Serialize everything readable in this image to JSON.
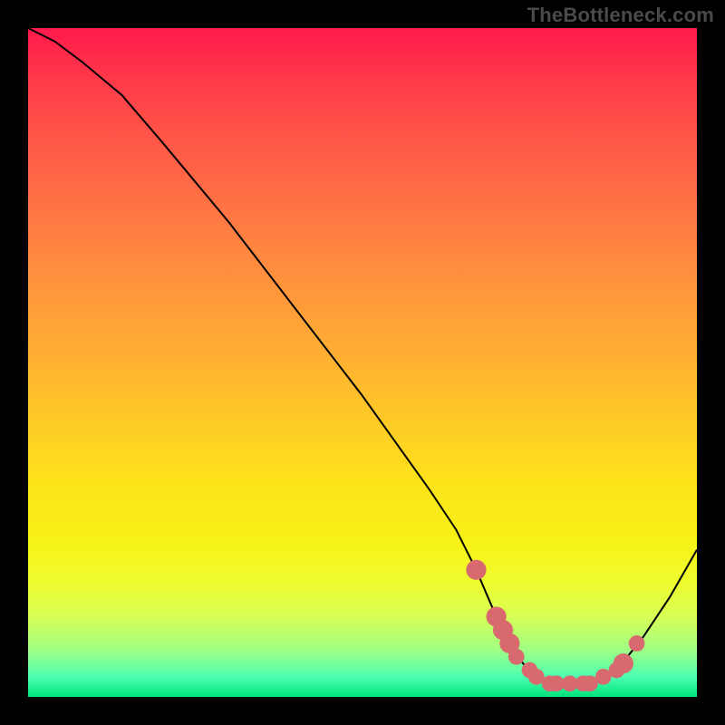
{
  "watermark": "TheBottleneck.com",
  "chart_data": {
    "type": "line",
    "title": "",
    "xlabel": "",
    "ylabel": "",
    "xlim": [
      0,
      100
    ],
    "ylim": [
      0,
      100
    ],
    "series": [
      {
        "name": "curve",
        "x": [
          0,
          4,
          8,
          14,
          20,
          30,
          40,
          50,
          60,
          64,
          67,
          70,
          72,
          74,
          76,
          78,
          80,
          82,
          84,
          86,
          88,
          92,
          96,
          100
        ],
        "values": [
          100,
          98,
          95,
          90,
          83,
          71,
          58,
          45,
          31,
          25,
          19,
          12,
          8,
          5,
          3,
          2,
          2,
          2,
          2,
          3,
          4,
          9,
          15,
          22
        ]
      }
    ],
    "markers": {
      "name": "highlighted-points",
      "color": "#d86a6f",
      "points": [
        {
          "x": 67,
          "y": 19,
          "r": 1.5
        },
        {
          "x": 70,
          "y": 12,
          "r": 1.5
        },
        {
          "x": 71,
          "y": 10,
          "r": 1.5
        },
        {
          "x": 72,
          "y": 8,
          "r": 1.5
        },
        {
          "x": 73,
          "y": 6,
          "r": 1.2
        },
        {
          "x": 75,
          "y": 4,
          "r": 1.2
        },
        {
          "x": 76,
          "y": 3,
          "r": 1.2
        },
        {
          "x": 78,
          "y": 2,
          "r": 1.2
        },
        {
          "x": 79,
          "y": 2,
          "r": 1.2
        },
        {
          "x": 81,
          "y": 2,
          "r": 1.2
        },
        {
          "x": 83,
          "y": 2,
          "r": 1.2
        },
        {
          "x": 84,
          "y": 2,
          "r": 1.2
        },
        {
          "x": 86,
          "y": 3,
          "r": 1.2
        },
        {
          "x": 88,
          "y": 4,
          "r": 1.2
        },
        {
          "x": 89,
          "y": 5,
          "r": 1.5
        },
        {
          "x": 91,
          "y": 8,
          "r": 1.2
        }
      ]
    }
  }
}
